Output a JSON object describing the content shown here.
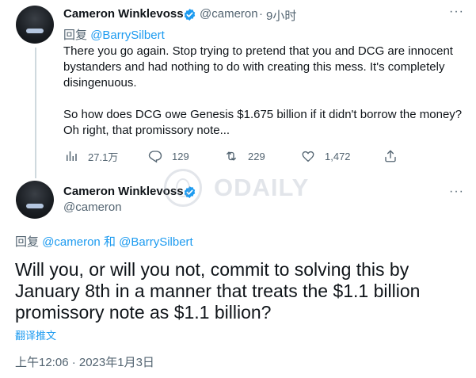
{
  "tweet1": {
    "author_name": "Cameron Winklevoss",
    "handle": "@cameron",
    "dot": "·",
    "time": "9小时",
    "reply_prefix": "回复",
    "reply_to": "@BarrySilbert",
    "lines": [
      "There you go again. Stop trying to pretend that you and DCG are innocent",
      "bystanders and had nothing to do with creating this mess. It's completely",
      "disingenuous.",
      "",
      "So how does DCG owe Genesis $1.675 billion if it didn't borrow the money?",
      "Oh right, that promissory note..."
    ],
    "actions": {
      "views": "27.1万",
      "replies": "129",
      "retweets": "229",
      "likes": "1,472"
    },
    "icons": [
      "views-icon",
      "reply-icon",
      "retweet-icon",
      "like-icon",
      "share-icon",
      "verified-icon",
      "more-icon"
    ]
  },
  "tweet2": {
    "author_name": "Cameron Winklevoss",
    "handle": "@cameron",
    "reply_prefix": "回复",
    "reply_to_1": "@cameron",
    "reply_and": "和",
    "reply_to_2": "@BarrySilbert",
    "lines": [
      "Will you, or will you not, commit to solving this by",
      "January 8th in a manner that treats the $1.1 billion",
      "promissory note as $1.1 billion?"
    ],
    "translate": "翻译推文",
    "timestamp": "上午12:06 · 2023年1月3日"
  },
  "watermark": {
    "text": "ODAILY"
  },
  "colors": {
    "accent": "#1d9bf0",
    "muted": "#536471",
    "text": "#0f1419",
    "divider": "#eff3f4"
  }
}
